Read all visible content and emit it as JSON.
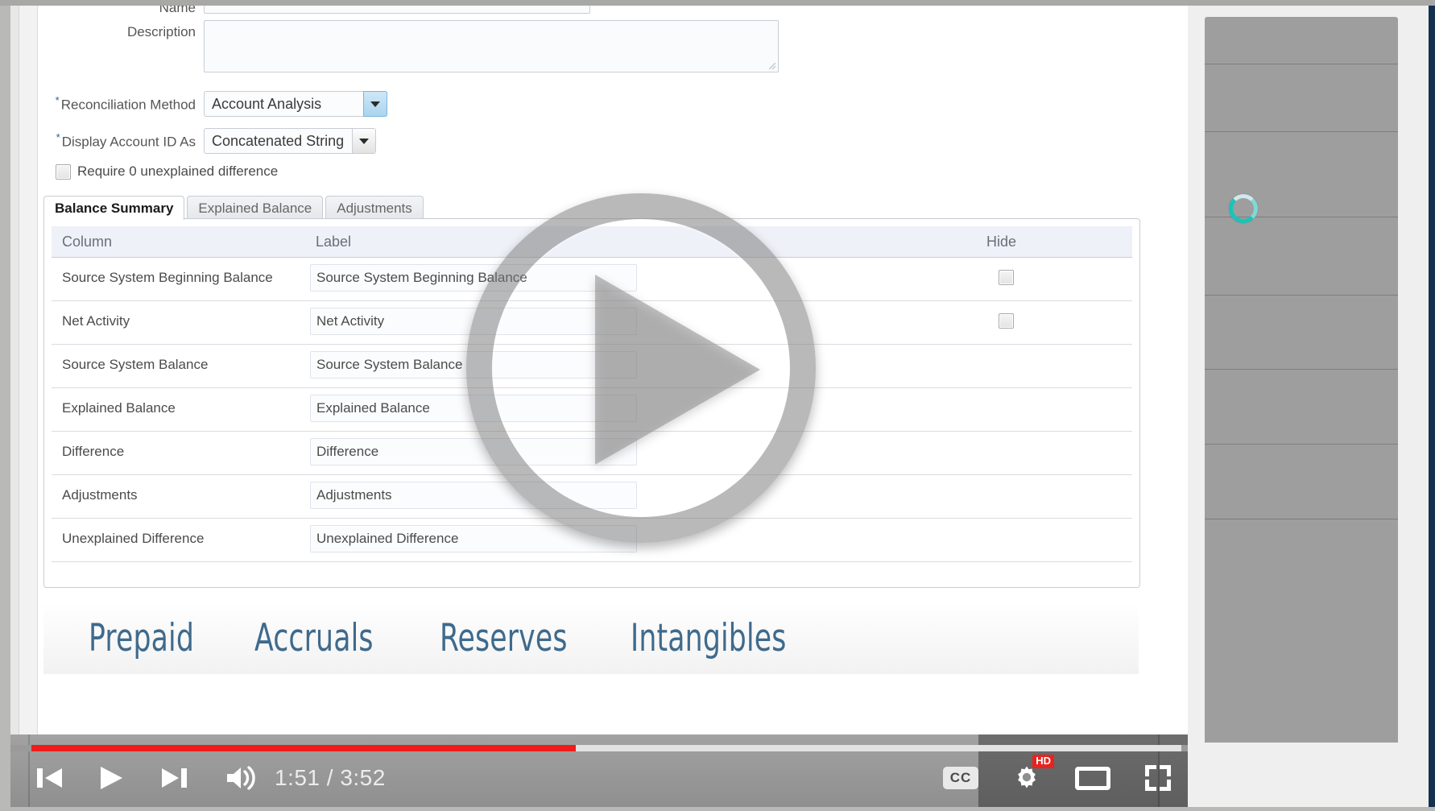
{
  "form": {
    "name_label": "Name",
    "description_label": "Description",
    "reconciliation_method": {
      "label": "Reconciliation Method",
      "value": "Account Analysis",
      "required": "*"
    },
    "display_account_id_as": {
      "label": "Display Account ID As",
      "value": "Concatenated String",
      "required": "*"
    },
    "require_zero_checkbox_label": "Require 0 unexplained difference"
  },
  "tabs": [
    {
      "label": "Balance Summary",
      "active": true
    },
    {
      "label": "Explained Balance",
      "active": false
    },
    {
      "label": "Adjustments",
      "active": false
    }
  ],
  "table": {
    "headers": {
      "column": "Column",
      "label": "Label",
      "hide": "Hide"
    },
    "rows": [
      {
        "column": "Source System Beginning Balance",
        "label": "Source System Beginning Balance",
        "hide": false,
        "has_checkbox": true
      },
      {
        "column": "Net Activity",
        "label": "Net Activity",
        "hide": false,
        "has_checkbox": true
      },
      {
        "column": "Source System Balance",
        "label": "Source System Balance",
        "hide": false,
        "has_checkbox": false
      },
      {
        "column": "Explained Balance",
        "label": "Explained Balance",
        "hide": false,
        "has_checkbox": false
      },
      {
        "column": "Difference",
        "label": "Difference",
        "hide": false,
        "has_checkbox": false
      },
      {
        "column": "Adjustments",
        "label": "Adjustments",
        "hide": false,
        "has_checkbox": false
      },
      {
        "column": "Unexplained Difference",
        "label": "Unexplained Difference",
        "hide": false,
        "has_checkbox": false
      }
    ]
  },
  "keywords": [
    "Prepaid",
    "Accruals",
    "Reserves",
    "Intangibles"
  ],
  "player": {
    "current_time": "1:51",
    "total_time": "3:52",
    "time_display": "1:51 / 3:52",
    "progress_percent": 48,
    "buffered_percent": 100,
    "state": "paused",
    "quality_badge": "HD",
    "captions_label": "CC",
    "controls": {
      "previous": "previous-video",
      "play": "play",
      "next": "next-video",
      "volume": "volume",
      "captions": "subtitles",
      "settings": "settings",
      "theater": "theater-mode",
      "fullscreen": "fullscreen"
    }
  },
  "colors": {
    "progress": "#f01b1b",
    "hd_badge": "#e8231f",
    "keyword_text": "#3f6a8c",
    "page_chrome": "#16304f",
    "spinner": "#19c4b8"
  }
}
